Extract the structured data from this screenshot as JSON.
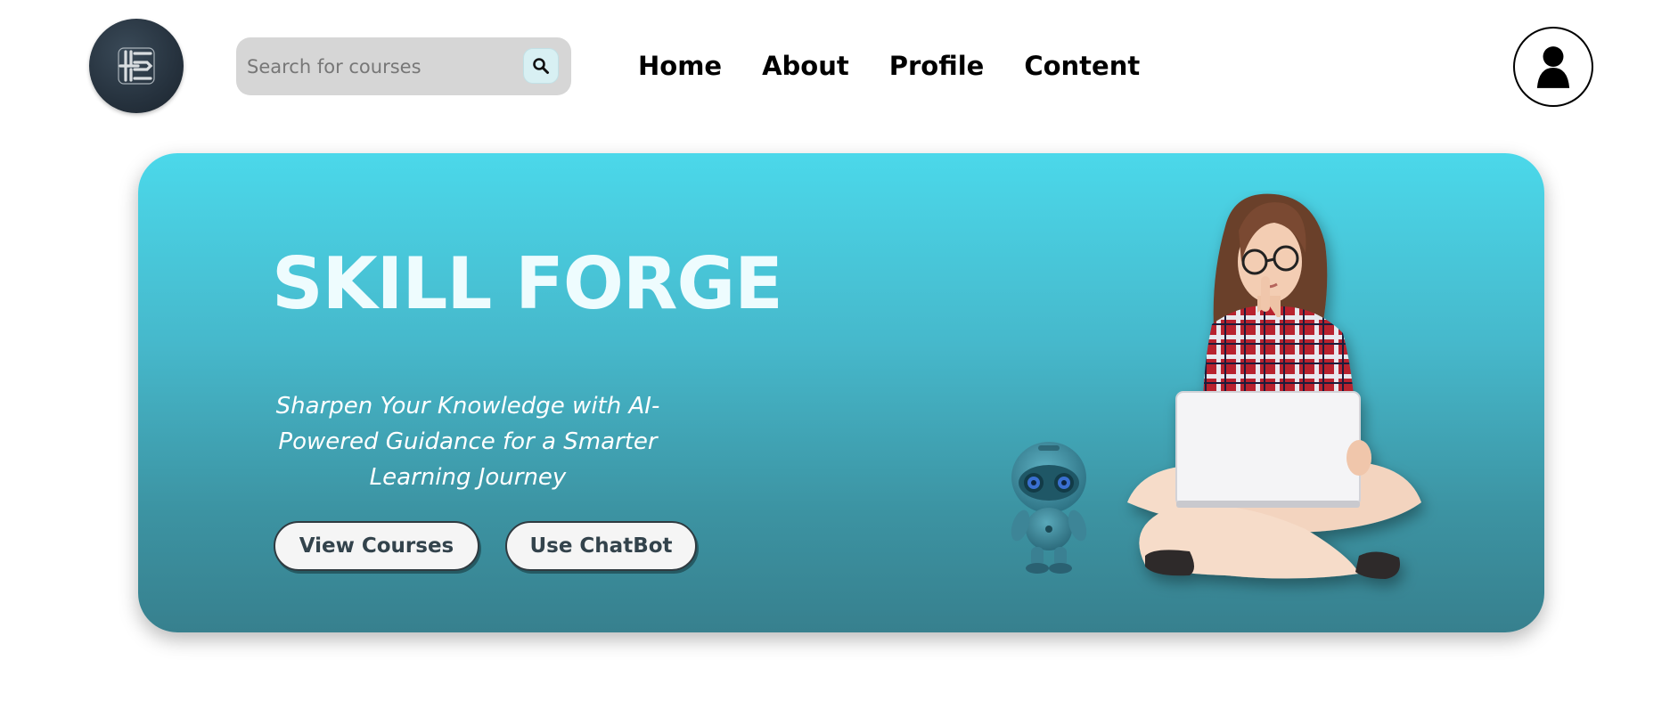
{
  "header": {
    "search": {
      "placeholder": "Search for courses",
      "value": ""
    },
    "nav": [
      {
        "label": "Home"
      },
      {
        "label": "About"
      },
      {
        "label": "Profile"
      },
      {
        "label": "Content"
      }
    ]
  },
  "hero": {
    "title": "SKILL FORGE",
    "tagline": "Sharpen Your Knowledge with AI-Powered Guidance for a Smarter Learning Journey",
    "buttons": {
      "view_courses": "View Courses",
      "use_chatbot": "Use ChatBot"
    }
  },
  "icons": {
    "logo": "skill-forge-logo",
    "search": "magnifier-icon",
    "profile": "user-icon"
  },
  "colors": {
    "hero_top": "#4bd8ea",
    "hero_bottom": "#37808e",
    "title_text": "#eefcfe",
    "button_bg": "#f5f5f5",
    "button_text": "#33434c",
    "search_bg": "#d6d6d6"
  }
}
